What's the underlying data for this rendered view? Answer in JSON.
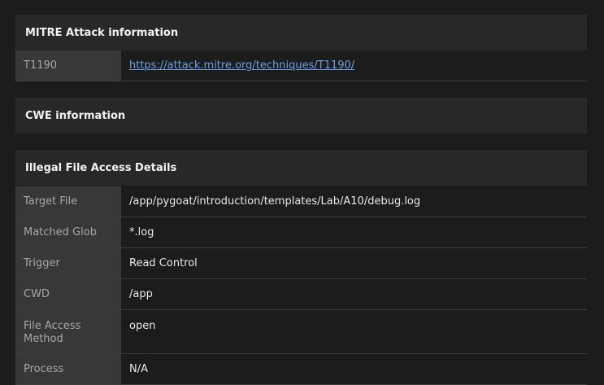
{
  "mitre": {
    "title": "MITRE Attack information",
    "technique_id": "T1190",
    "technique_url": "https://attack.mitre.org/techniques/T1190/"
  },
  "cwe": {
    "title": "CWE information"
  },
  "illegal_file_access": {
    "title": "Illegal File Access Details",
    "rows": [
      {
        "key": "Target File",
        "value": "/app/pygoat/introduction/templates/Lab/A10/debug.log"
      },
      {
        "key": "Matched Glob",
        "value": "*.log"
      },
      {
        "key": "Trigger",
        "value": "Read Control"
      },
      {
        "key": "CWD",
        "value": "/app"
      },
      {
        "key": "File Access Method",
        "value": "open"
      },
      {
        "key": "Process",
        "value": "N/A"
      }
    ]
  }
}
